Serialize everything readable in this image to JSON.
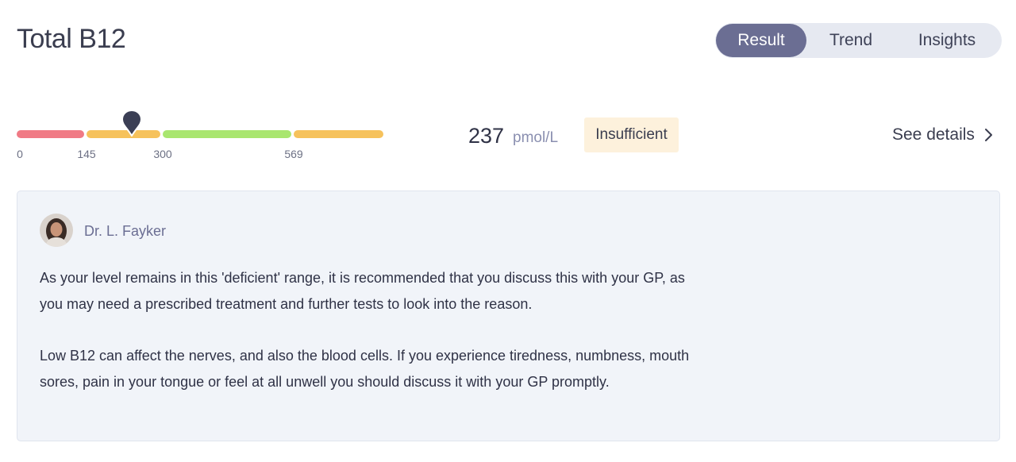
{
  "page": {
    "title": "Total B12"
  },
  "tabs": [
    {
      "label": "Result",
      "active": true
    },
    {
      "label": "Trend",
      "active": false
    },
    {
      "label": "Insights",
      "active": false
    }
  ],
  "range": {
    "ticks": [
      "0",
      "145",
      "300",
      "569"
    ],
    "marker_value": 237,
    "segment_colors": [
      "#f07a85",
      "#f6c25c",
      "#a9e66f",
      "#f6c25c"
    ]
  },
  "result": {
    "value": "237",
    "unit": "pmol/L",
    "status": "Insufficient",
    "status_color": "#fdf1dc",
    "details_label": "See details"
  },
  "comment": {
    "author": "Dr. L. Fayker",
    "paragraphs": [
      "As your level remains in this 'deficient' range, it is recommended that you discuss this with your GP, as you may need a prescribed treatment and further tests to look into the reason.",
      "Low B12 can affect the nerves, and also the blood cells. If you experience tiredness, numbness, mouth sores, pain in your tongue or feel at all unwell you should discuss it with your GP promptly."
    ]
  },
  "icons": {
    "details": "chevron-right-icon",
    "marker": "map-pin-icon"
  }
}
